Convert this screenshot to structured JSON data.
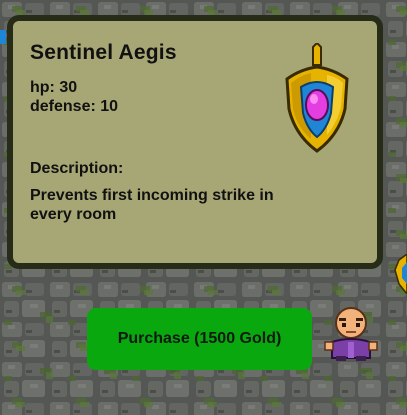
{
  "item": {
    "name": "Sentinel Aegis",
    "stats": [
      {
        "label": "hp",
        "value": 30
      },
      {
        "label": "defense",
        "value": 10
      }
    ],
    "description_heading": "Description:",
    "description": "Prevents first incoming strike in every room",
    "icon": "shield-icon"
  },
  "shop": {
    "purchase_label": "Purchase (1500 Gold)",
    "price_gold": 1500
  },
  "merchant": {
    "icon": "merchant-sprite"
  },
  "colors": {
    "panel_bg": "#a7a775",
    "panel_border": "#262c17",
    "button_bg": "#0aa80f",
    "shield_gold": "#e6b400",
    "shield_blue": "#1f86d6",
    "shield_gem": "#e43ee0"
  }
}
